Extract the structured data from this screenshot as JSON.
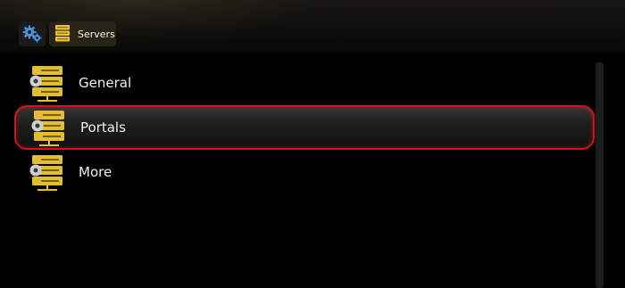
{
  "breadcrumb": {
    "settings_icon": "gears-icon",
    "current_icon": "server-icon",
    "current_label": "Servers"
  },
  "menu": {
    "items": [
      {
        "label": "General",
        "icon": "server-settings-icon",
        "selected": false
      },
      {
        "label": "Portals",
        "icon": "server-settings-icon",
        "selected": true
      },
      {
        "label": "More",
        "icon": "server-settings-icon",
        "selected": false
      }
    ]
  },
  "colors": {
    "accent_gold": "#e8c23a",
    "selection_outline": "#d2121f",
    "text": "#f1f1f1",
    "background": "#000000"
  }
}
